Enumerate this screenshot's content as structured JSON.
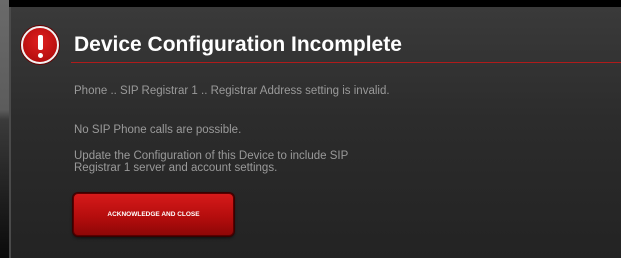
{
  "dialog": {
    "title": "Device Configuration Incomplete",
    "icon": "alert-exclamation-icon",
    "messages": [
      "Phone .. SIP Registrar 1 .. Registrar Address setting is invalid.",
      "No SIP Phone calls are possible.",
      "Update the Configuration of this Device to include SIP Registrar 1 server and account settings."
    ],
    "button_label": "ACKNOWLEDGE AND CLOSE"
  },
  "colors": {
    "accent": "#c41414",
    "title_text": "#ffffff",
    "body_text": "#9a9a9a",
    "background": "#2c2c2c"
  }
}
